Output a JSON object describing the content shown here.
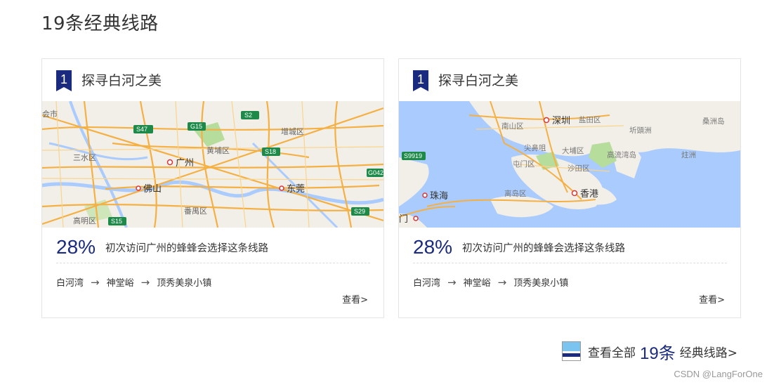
{
  "page": {
    "title": "19条经典线路"
  },
  "cards": [
    {
      "rank": "1",
      "title": "探寻白河之美",
      "percent": "28%",
      "stat_text": "初次访问广州的蜂蜂会选择这条线路",
      "route": [
        "白河湾",
        "神堂峪",
        "顶秀美泉小镇"
      ],
      "view_label": "查看>",
      "map_labels": {
        "guangzhou": "广州",
        "foshan": "佛山",
        "dongguan": "东莞",
        "zengcheng": "增城区",
        "huangpu": "黄埔区",
        "panyu": "番禺区",
        "sanshui": "三水区",
        "gaoming": "高明区",
        "huishi": "会市",
        "shields": [
          "S47",
          "G15",
          "S2",
          "S18",
          "G042",
          "S29",
          "S15"
        ]
      }
    },
    {
      "rank": "1",
      "title": "探寻白河之美",
      "percent": "28%",
      "stat_text": "初次访问广州的蜂蜂会选择这条线路",
      "route": [
        "白河湾",
        "神堂峪",
        "顶秀美泉小镇"
      ],
      "view_label": "查看>",
      "map_labels": {
        "shenzhen": "深圳",
        "hongkong": "香港",
        "zhuhai": "珠海",
        "macau": "门",
        "nanshan": "南山区",
        "yantian": "盐田区",
        "jianshaju": "尖鼻咀",
        "dapu": "大埔区",
        "tunmen": "屯门区",
        "shatian": "沙田区",
        "lidao": "离岛区",
        "gaoliu": "高流湾岛",
        "qitou": "圻頭洲",
        "niuzhou": "炷洲",
        "gaozhou": "桑洲岛",
        "shield": "S9919"
      }
    }
  ],
  "footer": {
    "prefix": "查看全部",
    "count": "19条",
    "suffix": "经典线路>"
  },
  "watermark": "CSDN @LangForOne",
  "colors": {
    "accent": "#1a2a7f",
    "road": "#f5b044",
    "water": "#aacbfd",
    "land": "#f2efe8"
  }
}
